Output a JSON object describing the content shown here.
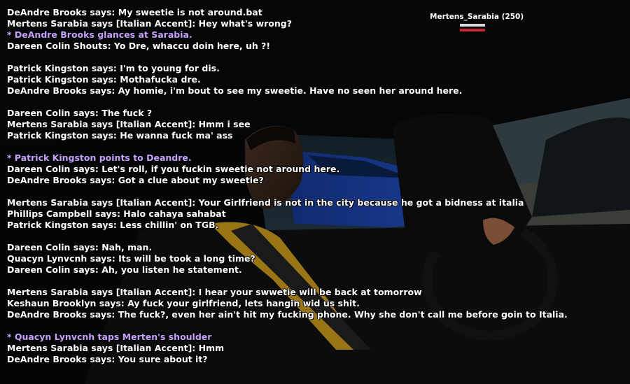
{
  "colors": {
    "chat_text": "#ffffff",
    "action_text": "#c6a2ff",
    "armor_bar": "#d9d9d9",
    "health_bar": "#c8252c"
  },
  "player_tag": {
    "label": "Mertens_Sarabia (250)",
    "armor_level": 1.0,
    "health_level": 1.0
  },
  "chat": [
    {
      "type": "say",
      "text": "DeAndre Brooks says: My sweetie is not around.bat"
    },
    {
      "type": "say",
      "text": "Mertens Sarabia says [Italian Accent]: Hey what's wrong?"
    },
    {
      "type": "action",
      "text": "* DeAndre Brooks glances at Sarabia."
    },
    {
      "type": "say",
      "text": "Dareen Colin Shouts: Yo Dre, whaccu doin here, uh ?!"
    },
    {
      "type": "blank",
      "text": ""
    },
    {
      "type": "say",
      "text": "Patrick Kingston says: I'm to young for dis."
    },
    {
      "type": "say",
      "text": "Patrick Kingston says: Mothafucka dre."
    },
    {
      "type": "say",
      "text": "DeAndre Brooks says: Ay homie, i'm bout to see my sweetie. Have no seen her around here."
    },
    {
      "type": "blank",
      "text": ""
    },
    {
      "type": "say",
      "text": "Dareen Colin says: The fuck ?"
    },
    {
      "type": "say",
      "text": "Mertens Sarabia says [Italian Accent]: Hmm i see"
    },
    {
      "type": "say",
      "text": "Patrick Kingston says: He wanna fuck ma' ass"
    },
    {
      "type": "blank",
      "text": ""
    },
    {
      "type": "action",
      "text": "* Patrick Kingston points to Deandre."
    },
    {
      "type": "say",
      "text": "Dareen Colin says: Let's roll, if you fuckin sweetie not around here."
    },
    {
      "type": "say",
      "text": "DeAndre Brooks says: Got a clue about my sweetie?"
    },
    {
      "type": "blank",
      "text": ""
    },
    {
      "type": "say",
      "text": "Mertens Sarabia says [Italian Accent]: Your Girlfriend is not in the city because he got a bidness at italia"
    },
    {
      "type": "say",
      "text": "Phillips Campbell says: Halo cahaya sahabat"
    },
    {
      "type": "say",
      "text": "Patrick Kingston says: Less chillin' on TGB."
    },
    {
      "type": "blank",
      "text": ""
    },
    {
      "type": "say",
      "text": "Dareen Colin says: Nah, man."
    },
    {
      "type": "say",
      "text": "Quacyn Lynvcnh says: Its will be took a long time?"
    },
    {
      "type": "say",
      "text": "Dareen Colin says: Ah, you listen he statement."
    },
    {
      "type": "blank",
      "text": ""
    },
    {
      "type": "say",
      "text": "Mertens Sarabia says [Italian Accent]: I hear your swwetie will be back at tomorrow"
    },
    {
      "type": "say",
      "text": "Keshaun Brooklyn says: Ay fuck your girlfriend, lets hangin wid us shit."
    },
    {
      "type": "say",
      "text": "DeAndre Brooks says: The fuck?, even her ain't hit my fucking phone. Why she don't call me before goin to Italia."
    },
    {
      "type": "blank",
      "text": ""
    },
    {
      "type": "action",
      "text": "* Quacyn Lynvcnh taps Merten's shoulder"
    },
    {
      "type": "say",
      "text": "Mertens Sarabia says [Italian Accent]: Hmm"
    },
    {
      "type": "say",
      "text": "DeAndre Brooks says: You sure about it?"
    }
  ]
}
